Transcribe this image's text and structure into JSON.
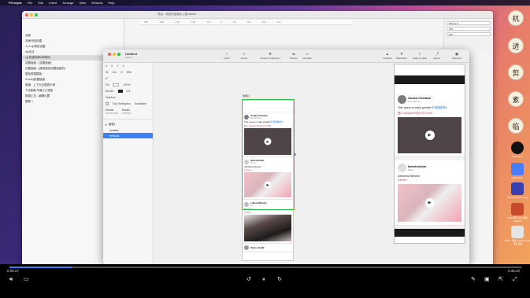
{
  "menubar": {
    "apple": "",
    "app_name": "Principle",
    "items": [
      "File",
      "Edit",
      "Insert",
      "Arrange",
      "View",
      "Window",
      "Help"
    ]
  },
  "back_window": {
    "title": "项目 - 动态作品演示上视 sketch",
    "layers": [
      "页面",
      "封面作品设置",
      "人人vip预防设置",
      "vip无法",
      "vip充值表单id单再用",
      "设置面面 - (设置面面)",
      "设置面面 - (使用遮挡设置面面的)",
      "图标数据模版",
      "ICon/ty配置链接",
      "情绪 - 上下交互图表示例",
      "下拉刷新 场景 (1) 搜索",
      "数据汇总 - 编辑位置",
      "图案 1"
    ],
    "ruler": [
      "-250",
      "-200",
      "-150",
      "-100",
      "-50",
      "0",
      "50",
      "100",
      "150",
      "200"
    ],
    "right_inputs": [
      "iPhone X",
      "375",
      "812"
    ]
  },
  "front_window": {
    "doc_title": "Untitled",
    "doc_subtitle": "Edited",
    "toolbar": [
      {
        "label": "Insert",
        "icon": "plus-icon"
      },
      {
        "label": "Import",
        "icon": "import-icon"
      },
      {
        "label": "Create Component",
        "icon": "component-icon"
      },
      {
        "label": "Drivers",
        "icon": "drivers-icon"
      },
      {
        "label": "Animate",
        "icon": "animate-icon"
      },
      {
        "label": "Forward",
        "icon": "forward-icon"
      },
      {
        "label": "Backward",
        "icon": "backward-icon"
      },
      {
        "label": "Share to Web",
        "icon": "share-icon"
      },
      {
        "label": "Export",
        "icon": "export-icon"
      },
      {
        "label": "Overview",
        "icon": "overview-icon"
      }
    ],
    "props": {
      "x": "0",
      "y": "0",
      "w": "414",
      "h": "896",
      "rotation": "0°",
      "fill_label": "Fill",
      "opacity": "100%",
      "border_label": "Border",
      "border_value": "0.5",
      "shadow_label": "Shadow",
      "clip_label": "Clip Sublayers",
      "scroll_label": "Scrollable",
      "h_label": "Elastic",
      "v_label": "Elastic",
      "h_mode": "Horizontal",
      "v_mode": "Vertical"
    },
    "layers": [
      "画板1",
      "content",
      "feedList"
    ],
    "artboard_label": "画板1"
  },
  "feed": [
    {
      "name": "Asuka Chinaka",
      "meta": "Recruitment",
      "text": "This users is really great#",
      "link": "#不用偶推荐#",
      "tag": "图片 Instagram作品分享 (F6/8)",
      "media": "dark"
    },
    {
      "name": "Iamchoclam",
      "meta": "Music",
      "text": "Adeshina Weston",
      "link": "",
      "tag": "Camera",
      "media": "pink"
    },
    {
      "name": "Lalisa Manoby",
      "meta": "Art",
      "text": "Everyone",
      "link": "",
      "tag": "Concert",
      "media": "photo"
    },
    {
      "name": "Steve de BB",
      "meta": "",
      "text": "",
      "link": "",
      "tag": "",
      "media": ""
    }
  ],
  "stickies": [
    "机",
    "进",
    "剪",
    "素",
    "临"
  ],
  "desktop_icons": [
    {
      "label": "Screenshot",
      "color": "#111111"
    },
    {
      "label": "Apple Editor",
      "color": "#4a7cff"
    },
    {
      "label": "The Format Stl 1.png",
      "color": "#3a3fb0"
    },
    {
      "label": "2024 项目 大文 选项 spaceX",
      "color": "#c84a2c"
    },
    {
      "label": "2022 - 项目 大文 Export 2 - 项目 副本",
      "color": "#e5e5e5"
    }
  ],
  "video": {
    "current_time": "0:05:27",
    "total_time": "0:45:20",
    "progress": 0.121,
    "accent": "#3b82f6"
  },
  "colors": {
    "selection": "#33c24d",
    "layer_active": "#3b82f6",
    "link": "#2f7bd8"
  }
}
